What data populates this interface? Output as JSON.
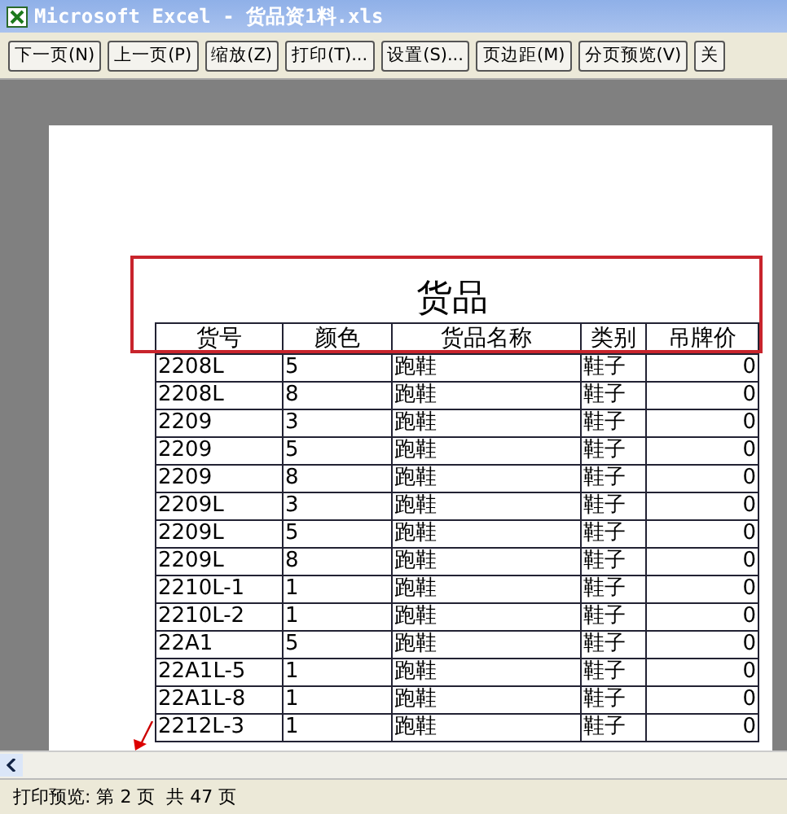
{
  "window": {
    "title": "Microsoft Excel - 货品资1料.xls"
  },
  "toolbar": [
    "下一页(N)",
    "上一页(P)",
    "缩放(Z)",
    "打印(T)...",
    "设置(S)...",
    "页边距(M)",
    "分页预览(V)",
    "关"
  ],
  "page": {
    "title": "货品",
    "columns": [
      "货号",
      "颜色",
      "货品名称",
      "类别",
      "吊牌价"
    ],
    "rows": [
      [
        "2208L",
        "5",
        "跑鞋",
        "鞋子",
        "0"
      ],
      [
        "2208L",
        "8",
        "跑鞋",
        "鞋子",
        "0"
      ],
      [
        "2209",
        "3",
        "跑鞋",
        "鞋子",
        "0"
      ],
      [
        "2209",
        "5",
        "跑鞋",
        "鞋子",
        "0"
      ],
      [
        "2209",
        "8",
        "跑鞋",
        "鞋子",
        "0"
      ],
      [
        "2209L",
        "3",
        "跑鞋",
        "鞋子",
        "0"
      ],
      [
        "2209L",
        "5",
        "跑鞋",
        "鞋子",
        "0"
      ],
      [
        "2209L",
        "8",
        "跑鞋",
        "鞋子",
        "0"
      ],
      [
        "2210L-1",
        "1",
        "跑鞋",
        "鞋子",
        "0"
      ],
      [
        "2210L-2",
        "1",
        "跑鞋",
        "鞋子",
        "0"
      ],
      [
        "22A1",
        "5",
        "跑鞋",
        "鞋子",
        "0"
      ],
      [
        "22A1L-5",
        "1",
        "跑鞋",
        "鞋子",
        "0"
      ],
      [
        "22A1L-8",
        "1",
        "跑鞋",
        "鞋子",
        "0"
      ],
      [
        "2212L-3",
        "1",
        "跑鞋",
        "鞋子",
        "0"
      ]
    ]
  },
  "status_bar": "打印预览: 第 2 页  共 47 页"
}
